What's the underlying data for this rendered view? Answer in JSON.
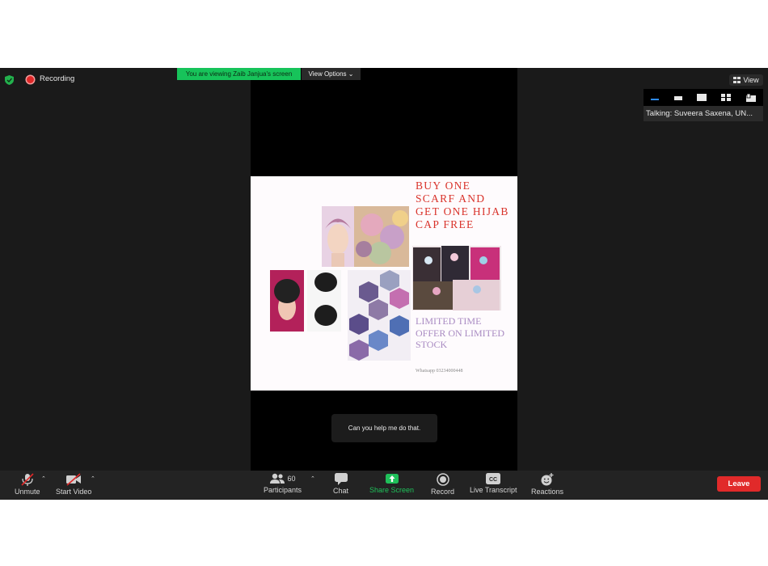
{
  "status": {
    "recording_label": "Recording"
  },
  "share_banner": {
    "viewing_text": "You are viewing Zaib Janjua's screen",
    "view_options_label": "View Options"
  },
  "view_button": {
    "label": "View"
  },
  "speaker": {
    "talking_text": "Talking: Suveera Saxena, UN..."
  },
  "poster": {
    "headline": "BUY ONE SCARF AND GET ONE HIJAB CAP FREE",
    "offer": "LIMITED TIME OFFER ON LIMITED STOCK",
    "whatsapp": "Whatsapp 03234000448"
  },
  "caption": {
    "text": "Can you help me do that."
  },
  "toolbar": {
    "unmute": "Unmute",
    "start_video": "Start Video",
    "participants": "Participants",
    "participants_count": "60",
    "chat": "Chat",
    "share_screen": "Share Screen",
    "record": "Record",
    "live_transcript": "Live Transcript",
    "reactions": "Reactions",
    "leave": "Leave"
  },
  "colors": {
    "window_bg": "#1a1a1a",
    "share_green": "#17c35a",
    "leave_red": "#e12a2a",
    "poster_headline": "#d9332b",
    "poster_offer": "#a98bc2"
  }
}
